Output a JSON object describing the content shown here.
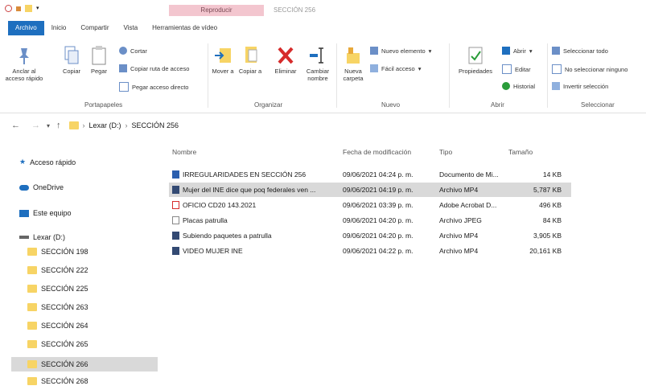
{
  "window": {
    "context_tab": "Reproducir",
    "title": "SECCIÓN 256"
  },
  "tabs": [
    "Archivo",
    "Inicio",
    "Compartir",
    "Vista",
    "Herramientas de vídeo"
  ],
  "ribbon": {
    "clipboard": {
      "pin_label": "Anclar al acceso rápido",
      "copy_label": "Copiar",
      "paste_label": "Pegar",
      "cut_label": "Cortar",
      "copy_path_label": "Copiar ruta de acceso",
      "paste_shortcut_label": "Pegar acceso directo",
      "group_label": "Portapapeles"
    },
    "organize": {
      "move_label": "Mover a",
      "copy_to_label": "Copiar a",
      "delete_label": "Eliminar",
      "rename_label": "Cambiar nombre",
      "group_label": "Organizar"
    },
    "new": {
      "new_folder_label": "Nueva carpeta",
      "new_item_label": "Nuevo elemento",
      "easy_access_label": "Fácil acceso",
      "group_label": "Nuevo"
    },
    "open": {
      "properties_label": "Propiedades",
      "open_label": "Abrir",
      "edit_label": "Editar",
      "history_label": "Historial",
      "group_label": "Abrir"
    },
    "select": {
      "select_all_label": "Seleccionar todo",
      "select_none_label": "No seleccionar ninguno",
      "invert_label": "Invertir selección",
      "group_label": "Seleccionar"
    }
  },
  "address": {
    "drive": "Lexar (D:)",
    "folder": "SECCIÓN 256"
  },
  "nav": {
    "quick_access": "Acceso rápido",
    "onedrive": "OneDrive",
    "this_pc": "Este equipo",
    "drive": "Lexar (D:)",
    "folders": [
      "SECCIÓN 198",
      "SECCIÓN 222",
      "SECCIÓN 225",
      "SECCIÓN 263",
      "SECCIÓN 264",
      "SECCIÓN 265",
      "SECCIÓN 266",
      "SECCIÓN 268"
    ]
  },
  "columns": {
    "name": "Nombre",
    "modified": "Fecha de modificación",
    "type": "Tipo",
    "size": "Tamaño"
  },
  "files": [
    {
      "name": "IRREGULARIDADES EN SECCIÓN 256",
      "modified": "09/06/2021 04:24 p. m.",
      "type": "Documento de Mi...",
      "size": "14 KB",
      "icon": "word-icon"
    },
    {
      "name": "Mujer del INE dice que poq federales ven ...",
      "modified": "09/06/2021 04:19 p. m.",
      "type": "Archivo MP4",
      "size": "5,787 KB",
      "icon": "video-icon"
    },
    {
      "name": "OFICIO CD20 143.2021",
      "modified": "09/06/2021 03:39 p. m.",
      "type": "Adobe Acrobat D...",
      "size": "496 KB",
      "icon": "pdf-icon"
    },
    {
      "name": "Placas patrulla",
      "modified": "09/06/2021 04:20 p. m.",
      "type": "Archivo JPEG",
      "size": "84 KB",
      "icon": "image-icon"
    },
    {
      "name": "Subiendo paquetes a patrulla",
      "modified": "09/06/2021 04:20 p. m.",
      "type": "Archivo MP4",
      "size": "3,905 KB",
      "icon": "video-icon"
    },
    {
      "name": "VIDEO MUJER INE",
      "modified": "09/06/2021 04:22 p. m.",
      "type": "Archivo MP4",
      "size": "20,161 KB",
      "icon": "video-icon"
    }
  ],
  "colors": {
    "accent": "#1e6fbf",
    "folder": "#f7d465",
    "context_tab": "#f3c6cf",
    "selection": "#d9d9d9"
  }
}
